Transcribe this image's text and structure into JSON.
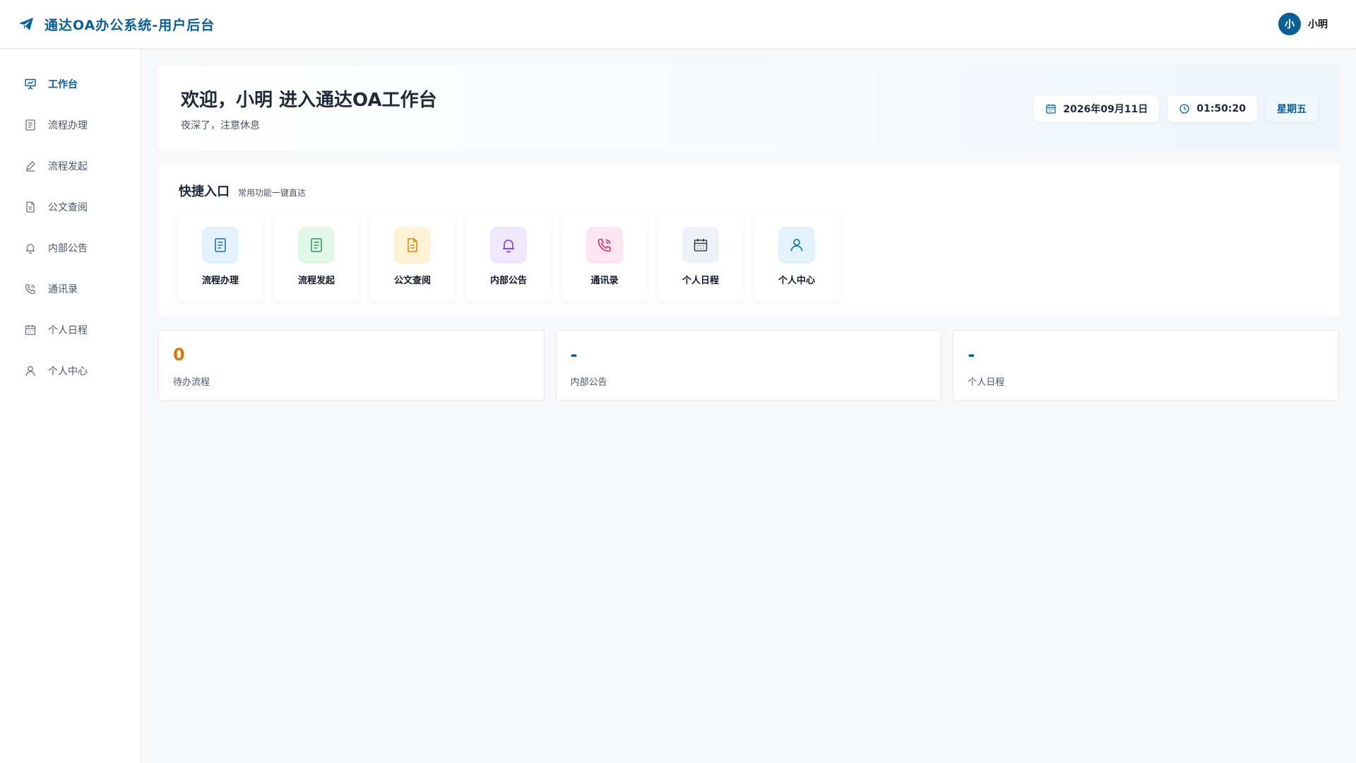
{
  "app": {
    "title": "通达OA办公系统-用户后台",
    "brand_color": "#0b5e96"
  },
  "user": {
    "avatar_text": "小",
    "name": "小明"
  },
  "sidebar": {
    "items": [
      {
        "label": "工作台",
        "icon": "presentation-chart-icon",
        "active": true
      },
      {
        "label": "流程办理",
        "icon": "document-list-icon",
        "active": false
      },
      {
        "label": "流程发起",
        "icon": "pen-icon",
        "active": false
      },
      {
        "label": "公文查阅",
        "icon": "file-text-icon",
        "active": false
      },
      {
        "label": "内部公告",
        "icon": "bell-icon",
        "active": false
      },
      {
        "label": "通讯录",
        "icon": "phone-icon",
        "active": false
      },
      {
        "label": "个人日程",
        "icon": "calendar-icon",
        "active": false
      },
      {
        "label": "个人中心",
        "icon": "user-icon",
        "active": false
      }
    ]
  },
  "welcome": {
    "title": "欢迎，小明 进入通达OA工作台",
    "subtitle": "夜深了，注意休息",
    "date": "2026年09月11日",
    "time": "01:50:20",
    "weekday": "星期五"
  },
  "quick_access": {
    "title": "快捷入口",
    "subtitle": "常用功能一键直达",
    "items": [
      {
        "label": "流程办理",
        "icon": "document-list-icon",
        "bg": "#e3f1fc",
        "fg": "#1f6fae"
      },
      {
        "label": "流程发起",
        "icon": "document-list-icon",
        "bg": "#e1f7ea",
        "fg": "#2f9e5c"
      },
      {
        "label": "公文查阅",
        "icon": "file-text-icon",
        "bg": "#fdf1d6",
        "fg": "#d98a0b"
      },
      {
        "label": "内部公告",
        "icon": "bell-icon",
        "bg": "#efe7fb",
        "fg": "#7c3aed"
      },
      {
        "label": "通讯录",
        "icon": "phone-icon",
        "bg": "#fde6f1",
        "fg": "#db2777"
      },
      {
        "label": "个人日程",
        "icon": "calendar-icon",
        "bg": "#eef1f5",
        "fg": "#374151"
      },
      {
        "label": "个人中心",
        "icon": "user-icon",
        "bg": "#e3f1fa",
        "fg": "#0e7490"
      }
    ]
  },
  "stats": [
    {
      "value": "0",
      "label": "待办流程",
      "color": "#d97706"
    },
    {
      "value": "-",
      "label": "内部公告",
      "color": "#0b5e96"
    },
    {
      "value": "-",
      "label": "个人日程",
      "color": "#0b5e96"
    }
  ]
}
